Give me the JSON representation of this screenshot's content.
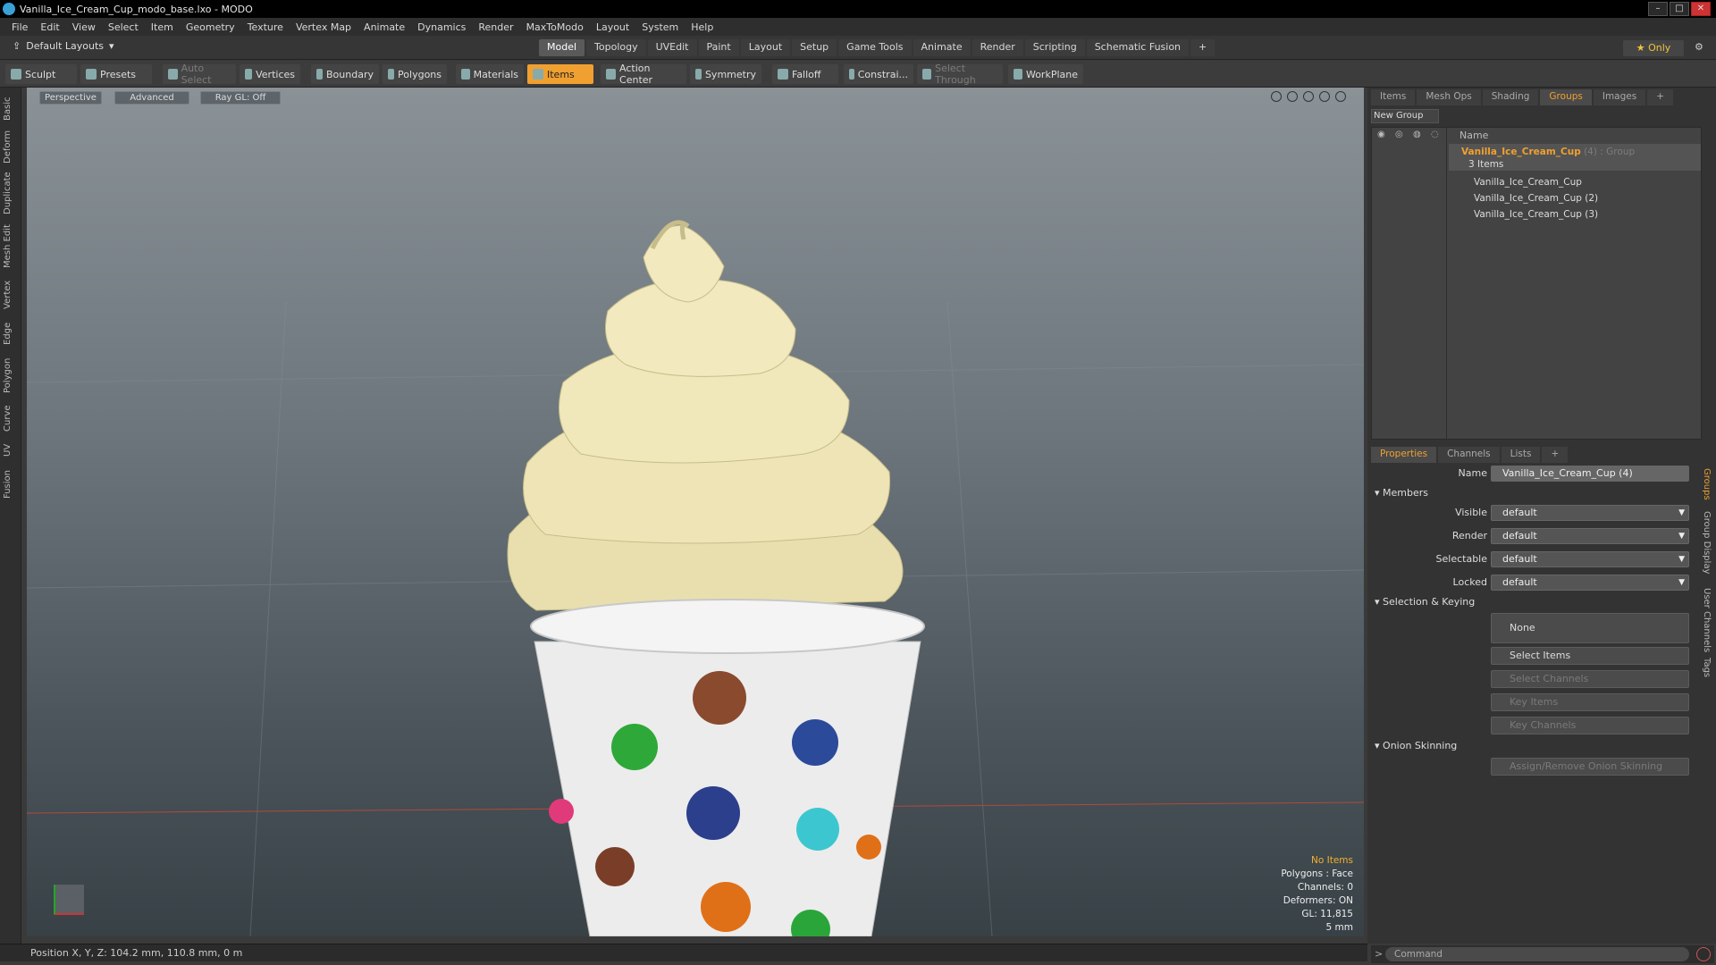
{
  "window": {
    "title": "Vanilla_Ice_Cream_Cup_modo_base.lxo - MODO"
  },
  "menubar": [
    "File",
    "Edit",
    "View",
    "Select",
    "Item",
    "Geometry",
    "Texture",
    "Vertex Map",
    "Animate",
    "Dynamics",
    "Render",
    "MaxToModo",
    "Layout",
    "System",
    "Help"
  ],
  "layoutbar": {
    "layout_select": "Default Layouts",
    "tabs": [
      "Model",
      "Topology",
      "UVEdit",
      "Paint",
      "Layout",
      "Setup",
      "Game Tools",
      "Animate",
      "Render",
      "Scripting",
      "Schematic Fusion"
    ],
    "active_tab": "Model",
    "only_label": "Only"
  },
  "toolbar": {
    "sculpt": "Sculpt",
    "presets": "Presets",
    "auto_select": "Auto Select",
    "vertices": "Vertices",
    "boundary": "Boundary",
    "polygons": "Polygons",
    "materials": "Materials",
    "items": "Items",
    "action_center": "Action Center",
    "symmetry": "Symmetry",
    "falloff": "Falloff",
    "constraints": "Constrai...",
    "select_through": "Select Through",
    "workplane": "WorkPlane"
  },
  "left_tabs": [
    "Basic",
    "Deform",
    "Duplicate",
    "Mesh Edit",
    "Vertex",
    "Edge",
    "Polygon",
    "Curve",
    "UV",
    "Fusion"
  ],
  "viewport": {
    "view_mode": "Perspective",
    "shading": "Advanced",
    "raygl": "Ray GL: Off",
    "info": {
      "selection": "No Items",
      "polygons": "Polygons : Face",
      "channels": "Channels: 0",
      "deformers": "Deformers: ON",
      "gl": "GL: 11,815",
      "scale": "5 mm"
    }
  },
  "status": {
    "position": "Position X, Y, Z:  104.2 mm, 110.8 mm, 0 m"
  },
  "right_panel": {
    "tabs": [
      "Items",
      "Mesh Ops",
      "Shading",
      "Groups",
      "Images"
    ],
    "active_tab": "Groups",
    "new_group": "New Group",
    "tree_header": "Name",
    "group": {
      "name": "Vanilla_Ice_Cream_Cup",
      "count": "(4)",
      "type": ": Group",
      "items_count": "3 Items"
    },
    "items": [
      "Vanilla_Ice_Cream_Cup",
      "Vanilla_Ice_Cream_Cup (2)",
      "Vanilla_Ice_Cream_Cup (3)"
    ]
  },
  "properties": {
    "tabs": [
      "Properties",
      "Channels",
      "Lists"
    ],
    "active_tab": "Properties",
    "name_label": "Name",
    "name_value": "Vanilla_Ice_Cream_Cup (4)",
    "members": "Members",
    "visible_label": "Visible",
    "visible_value": "default",
    "render_label": "Render",
    "render_value": "default",
    "selectable_label": "Selectable",
    "selectable_value": "default",
    "locked_label": "Locked",
    "locked_value": "default",
    "selection_keying": "Selection & Keying",
    "none": "None",
    "select_items": "Select Items",
    "select_channels": "Select Channels",
    "key_items": "Key Items",
    "key_channels": "Key Channels",
    "onion_skinning": "Onion Skinning",
    "assign_onion": "Assign/Remove Onion Skinning",
    "side_tabs": [
      "Groups",
      "Group Display",
      "User Channels",
      "Tags"
    ]
  },
  "command": {
    "placeholder": "Command"
  }
}
